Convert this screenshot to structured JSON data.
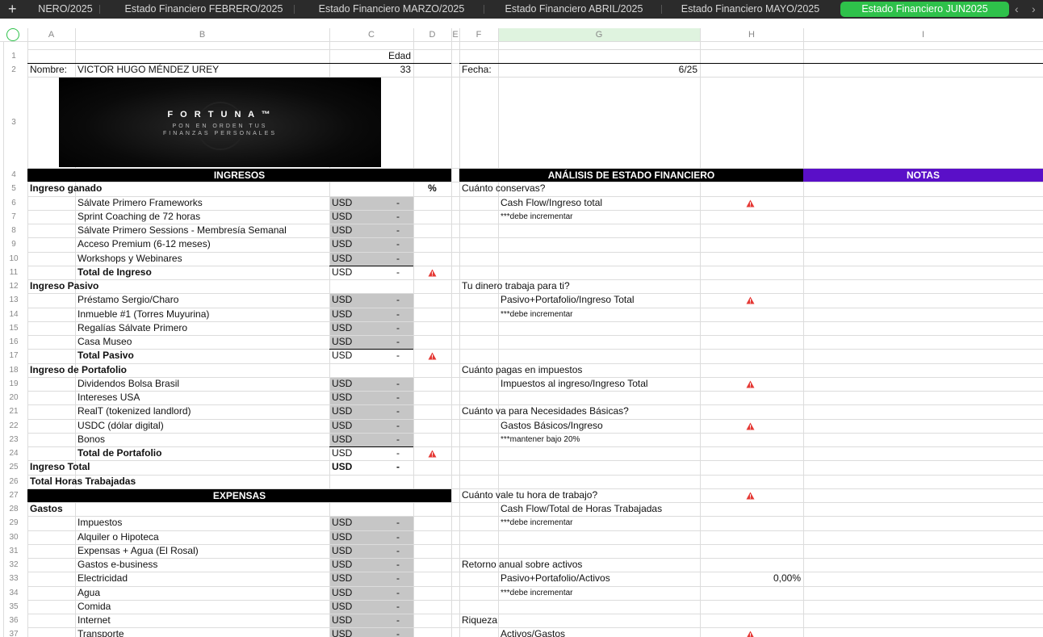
{
  "tabs": [
    {
      "label": "NERO/2025",
      "active": false
    },
    {
      "label": "Estado Financiero FEBRERO/2025",
      "active": false
    },
    {
      "label": "Estado Financiero MARZO/2025",
      "active": false
    },
    {
      "label": "Estado Financiero ABRIL/2025",
      "active": false
    },
    {
      "label": "Estado Financiero MAYO/2025",
      "active": false
    },
    {
      "label": "Estado Financiero JUN2025",
      "active": true
    }
  ],
  "columns": [
    "A",
    "B",
    "C",
    "D",
    "E",
    "F",
    "G",
    "H",
    "I"
  ],
  "rows": [
    "1",
    "2",
    "3",
    "4",
    "5",
    "6",
    "7",
    "8",
    "9",
    "10",
    "11",
    "12",
    "13",
    "14",
    "15",
    "16",
    "17",
    "18",
    "19",
    "20",
    "21",
    "22",
    "23",
    "24",
    "25",
    "26",
    "27",
    "28",
    "29",
    "30",
    "31",
    "32",
    "33",
    "34",
    "35",
    "36",
    "37"
  ],
  "header": {
    "edad_label": "Edad",
    "nombre_label": "Nombre:",
    "nombre_value": "VICTOR HUGO MÉNDEZ UREY",
    "edad_value": "33",
    "fecha_label": "Fecha:",
    "fecha_value": "6/25"
  },
  "logo": {
    "brand": "F O R T U N A ™",
    "tagline1": "PON EN ORDEN TUS",
    "tagline2": "FINANZAS PERSONALES"
  },
  "sections": {
    "ingresos": "INGRESOS",
    "analisis": "ANÁLISIS DE ESTADO FINANCIERO",
    "notas": "NOTAS",
    "expensas": "EXPENSAS",
    "percent": "%"
  },
  "currency": "USD",
  "dash": "-",
  "left_rows": [
    {
      "row": 5,
      "label": "Ingreso ganado",
      "bold": true,
      "indent": false
    },
    {
      "row": 6,
      "label": "Sálvate Primero Frameworks",
      "usd": true
    },
    {
      "row": 7,
      "label": "Sprint Coaching de 72 horas",
      "usd": true
    },
    {
      "row": 8,
      "label": "Sálvate Primero Sessions - Membresía Semanal",
      "usd": true
    },
    {
      "row": 9,
      "label": "Acceso Premium (6-12 meses)",
      "usd": true
    },
    {
      "row": 10,
      "label": "Workshops y Webinares",
      "usd": true
    },
    {
      "row": 11,
      "label": "Total de Ingreso",
      "bold": true,
      "usd": true,
      "total": true
    },
    {
      "row": 12,
      "label": "Ingreso Pasivo",
      "bold": true,
      "indent": false
    },
    {
      "row": 13,
      "label": "Préstamo Sergio/Charo",
      "usd": true
    },
    {
      "row": 14,
      "label": "Inmueble #1 (Torres Muyurina)",
      "usd": true
    },
    {
      "row": 15,
      "label": "Regalías Sálvate Primero",
      "usd": true
    },
    {
      "row": 16,
      "label": "Casa Museo",
      "usd": true
    },
    {
      "row": 17,
      "label": "Total Pasivo",
      "bold": true,
      "usd": true,
      "total": true
    },
    {
      "row": 18,
      "label": "Ingreso de Portafolio",
      "bold": true,
      "indent": false
    },
    {
      "row": 19,
      "label": "Dividendos Bolsa Brasil",
      "usd": true
    },
    {
      "row": 20,
      "label": "Intereses USA",
      "usd": true
    },
    {
      "row": 21,
      "label": "RealT (tokenized landlord)",
      "usd": true
    },
    {
      "row": 22,
      "label": "USDC (dólar digital)",
      "usd": true
    },
    {
      "row": 23,
      "label": "Bonos",
      "usd": true
    },
    {
      "row": 24,
      "label": "Total de Portafolio",
      "bold": true,
      "usd": true,
      "total": true
    },
    {
      "row": 25,
      "label": "Ingreso Total",
      "bold": true,
      "indent": false,
      "usd": true,
      "grand": true
    },
    {
      "row": 26,
      "label": "Total Horas Trabajadas",
      "bold": true,
      "indent": false
    },
    {
      "row": 28,
      "label": "Gastos",
      "bold": true,
      "indent": false
    },
    {
      "row": 29,
      "label": "Impuestos",
      "usd": true
    },
    {
      "row": 30,
      "label": "Alquiler o Hipoteca",
      "usd": true
    },
    {
      "row": 31,
      "label": "Expensas + Agua (El Rosal)",
      "usd": true
    },
    {
      "row": 32,
      "label": "Gastos e-business",
      "usd": true
    },
    {
      "row": 33,
      "label": "Electricidad",
      "usd": true
    },
    {
      "row": 34,
      "label": "Agua",
      "usd": true
    },
    {
      "row": 35,
      "label": "Comida",
      "usd": true
    },
    {
      "row": 36,
      "label": "Internet",
      "usd": true
    },
    {
      "row": 37,
      "label": "Transporte",
      "usd": true
    }
  ],
  "right_rows": [
    {
      "row": 5,
      "col": "F",
      "text": "Cuánto conservas?"
    },
    {
      "row": 6,
      "col": "G",
      "text": "Cash Flow/Ingreso total",
      "warn": true
    },
    {
      "row": 7,
      "col": "G",
      "text": "***debe incrementar",
      "small": true
    },
    {
      "row": 12,
      "col": "F",
      "text": "Tu dinero trabaja para ti?"
    },
    {
      "row": 13,
      "col": "G",
      "text": "Pasivo+Portafolio/Ingreso Total",
      "warn": true
    },
    {
      "row": 14,
      "col": "G",
      "text": "***debe incrementar",
      "small": true
    },
    {
      "row": 18,
      "col": "F",
      "text": "Cuánto pagas en impuestos"
    },
    {
      "row": 19,
      "col": "G",
      "text": "Impuestos al ingreso/Ingreso Total",
      "warn": true
    },
    {
      "row": 21,
      "col": "F",
      "text": "Cuánto va para Necesidades Básicas?"
    },
    {
      "row": 22,
      "col": "G",
      "text": "Gastos Básicos/Ingreso",
      "warn": true
    },
    {
      "row": 23,
      "col": "G",
      "text": "***mantener bajo 20%",
      "small": true
    },
    {
      "row": 27,
      "col": "F",
      "text": "Cuánto vale tu hora de trabajo?",
      "warn": true
    },
    {
      "row": 28,
      "col": "G",
      "text": "Cash Flow/Total de Horas Trabajadas"
    },
    {
      "row": 29,
      "col": "G",
      "text": "***debe incrementar",
      "small": true
    },
    {
      "row": 32,
      "col": "F",
      "text": "Retorno anual sobre activos"
    },
    {
      "row": 33,
      "col": "G",
      "text": "Pasivo+Portafolio/Activos",
      "value": "0,00%"
    },
    {
      "row": 34,
      "col": "G",
      "text": "***debe incrementar",
      "small": true
    },
    {
      "row": 36,
      "col": "F",
      "text": "Riqueza"
    },
    {
      "row": 37,
      "col": "G",
      "text": "Activos/Gastos",
      "warn": true
    }
  ],
  "colors": {
    "tabbar": "#2b2b2b",
    "active_tab": "#2ec14a",
    "section_header": "#000000",
    "notas_header": "#5a0fc8",
    "usd_fill": "#c6c6c6",
    "selected_col": "#dff3df",
    "warning": "#e53935"
  }
}
